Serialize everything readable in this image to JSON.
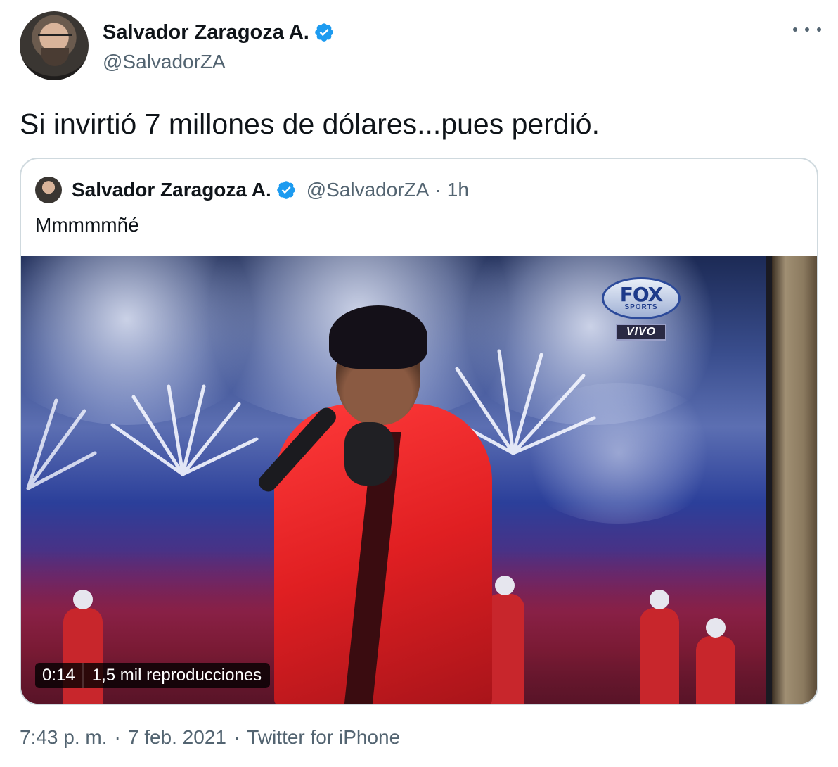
{
  "author": {
    "name": "Salvador Zaragoza A.",
    "handle": "@SalvadorZA",
    "verified": true
  },
  "tweet": {
    "text": "Si invirtió 7 millones de dólares...pues perdió.",
    "time": "7:43 p. m.",
    "separator": "·",
    "date": "7 feb. 2021",
    "source": "Twitter for iPhone"
  },
  "quoted_tweet": {
    "name": "Salvador Zaragoza A.",
    "handle": "@SalvadorZA",
    "separator": "·",
    "age": "1h",
    "text": "Mmmmmñé",
    "media": {
      "type": "video",
      "duration": "0:14",
      "views": "1,5 mil reproducciones",
      "broadcaster_logo": "FOX",
      "broadcaster_sub": "SPORTS",
      "live_badge": "VIVO"
    }
  },
  "colors": {
    "text": "#0f1419",
    "secondary": "#536471",
    "verified": "#1d9bf0",
    "border": "#cfd9de"
  },
  "icons": {
    "verified": "verified-badge-icon",
    "more": "more-options-icon"
  }
}
